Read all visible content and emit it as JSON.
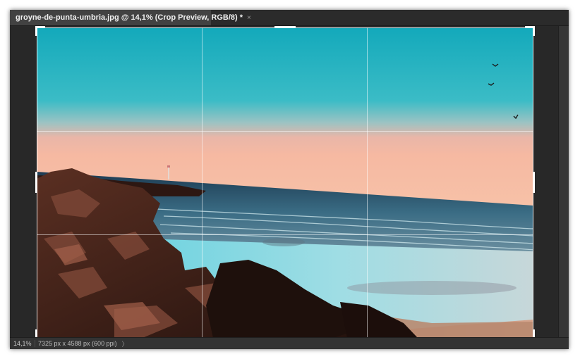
{
  "document": {
    "tab_title": "groyne-de-punta-umbria.jpg @ 14,1% (Crop Preview, RGB/8) *",
    "close_glyph": "×"
  },
  "canvas": {
    "image_subject": "beach-sunset-photo",
    "overlay": "rule-of-thirds-grid",
    "colors": {
      "sky_top": "#1fb0c0",
      "sky_horizon": "#f4b8a4",
      "sea": "#2d5a70",
      "sand": "#b8876a",
      "rocks": "#3a1f18"
    }
  },
  "status": {
    "zoom": "14,1%",
    "doc_size": "7325 px x 4588 px (600 ppi)",
    "arrow_glyph": "〉"
  }
}
